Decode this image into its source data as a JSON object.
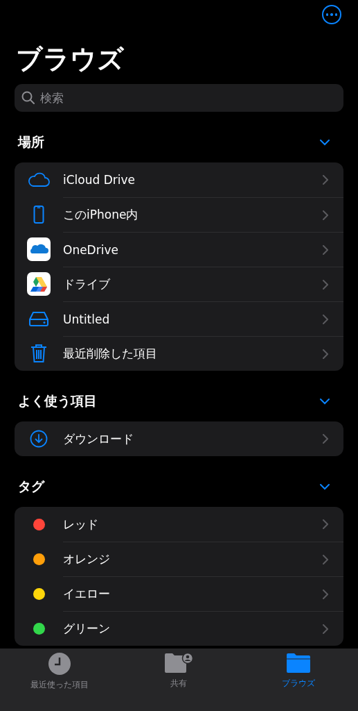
{
  "header": {
    "title": "ブラウズ"
  },
  "search": {
    "placeholder": "検索"
  },
  "sections": [
    {
      "title": "場所",
      "expanded": true,
      "items": [
        {
          "kind": "cloud",
          "label": "iCloud Drive"
        },
        {
          "kind": "phone",
          "label": "このiPhone内"
        },
        {
          "kind": "onedrive",
          "label": "OneDrive"
        },
        {
          "kind": "gdrive",
          "label": "ドライブ"
        },
        {
          "kind": "disk",
          "label": "Untitled"
        },
        {
          "kind": "trash",
          "label": "最近削除した項目"
        }
      ]
    },
    {
      "title": "よく使う項目",
      "expanded": true,
      "items": [
        {
          "kind": "download",
          "label": "ダウンロード"
        }
      ]
    },
    {
      "title": "タグ",
      "expanded": true,
      "items": [
        {
          "kind": "tag",
          "label": "レッド",
          "color": "#ff453a"
        },
        {
          "kind": "tag",
          "label": "オレンジ",
          "color": "#ff9f0a"
        },
        {
          "kind": "tag",
          "label": "イエロー",
          "color": "#ffd60a"
        },
        {
          "kind": "tag",
          "label": "グリーン",
          "color": "#32d74b"
        }
      ]
    }
  ],
  "tab_bar": [
    {
      "kind": "clock",
      "label": "最近使った項目",
      "selected": false
    },
    {
      "kind": "shared",
      "label": "共有",
      "selected": false
    },
    {
      "kind": "folder",
      "label": "ブラウズ",
      "selected": true
    }
  ]
}
